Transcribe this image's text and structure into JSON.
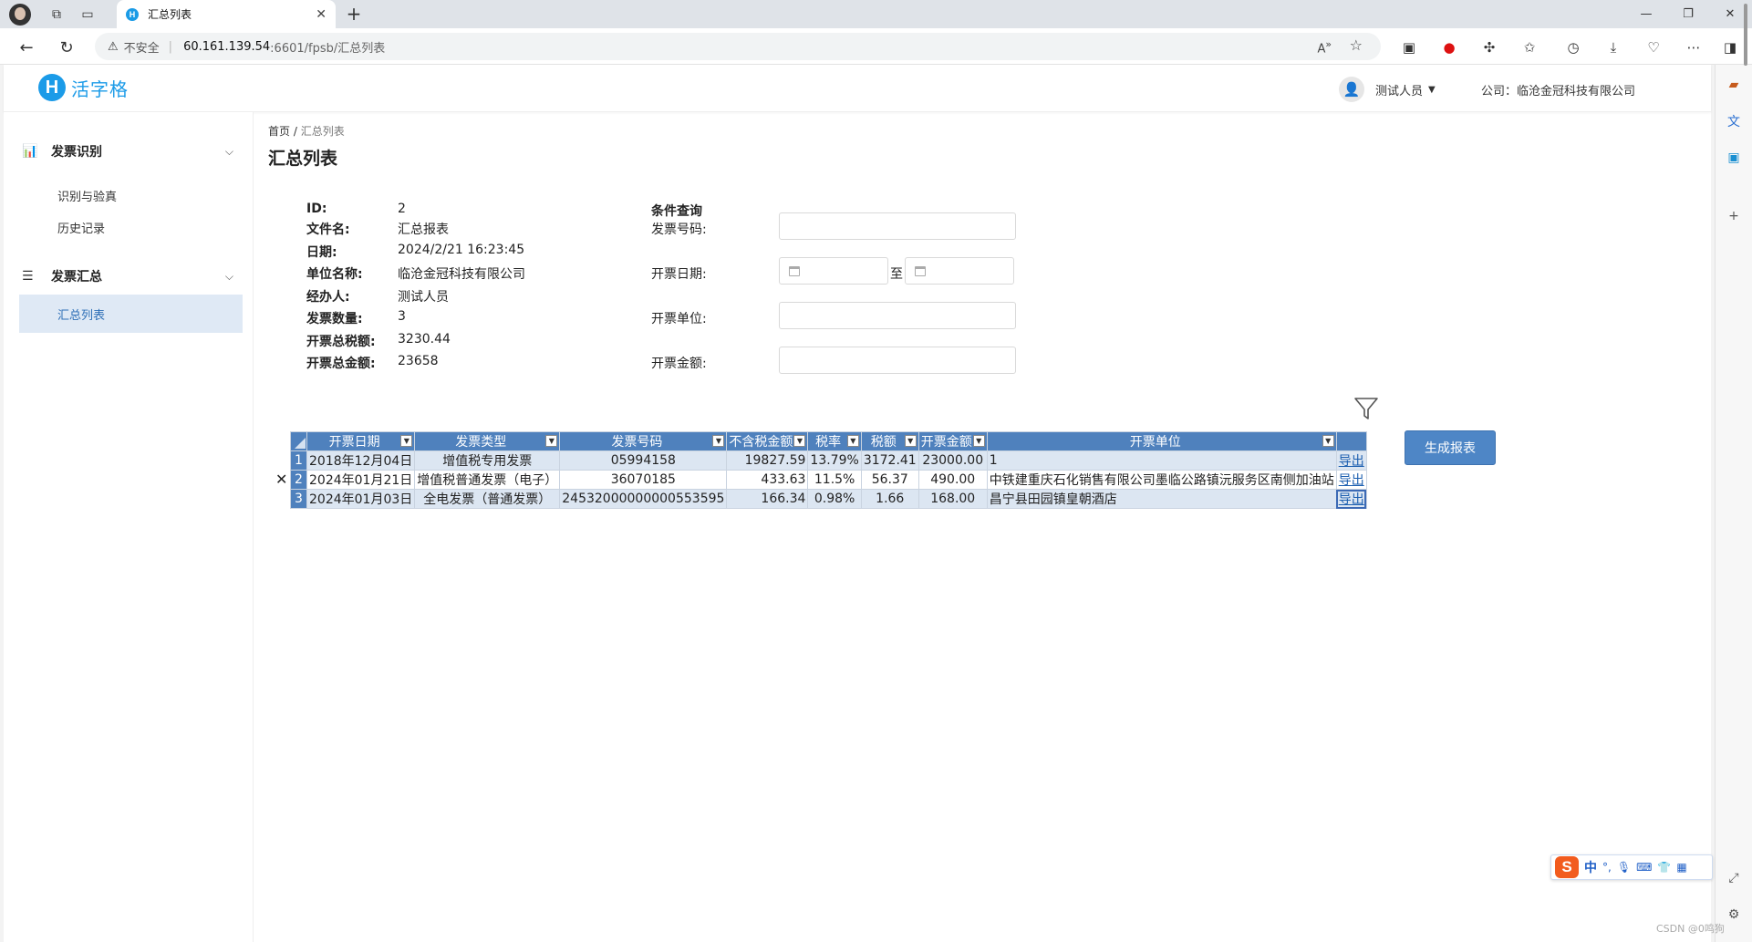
{
  "browser": {
    "tab_title": "汇总列表",
    "tab_favicon": "H",
    "url_warning": "不安全",
    "url_host": "60.161.139.54",
    "url_rest": ":6601/fpsb/汇总列表",
    "new_tab": "+",
    "minimize": "—",
    "restore": "❐",
    "close": "✕"
  },
  "app": {
    "logo_mark": "H",
    "brand": "活字格",
    "user_name": "测试人员",
    "company_label": "公司：临沧金冠科技有限公司"
  },
  "sidebar": {
    "groups": [
      {
        "label": "发票识别",
        "icon": "bar-chart-icon"
      },
      {
        "label": "发票汇总",
        "icon": "document-icon"
      }
    ],
    "items": [
      {
        "label": "识别与验真"
      },
      {
        "label": "历史记录"
      },
      {
        "label": "汇总列表",
        "active": true
      }
    ]
  },
  "breadcrumb": {
    "home": "首页 /",
    "current": "汇总列表"
  },
  "page_title": "汇总列表",
  "info": [
    {
      "label": "ID:",
      "value": "2"
    },
    {
      "label": "文件名:",
      "value": "汇总报表"
    },
    {
      "label": "日期:",
      "value": "2024/2/21 16:23:45"
    },
    {
      "label": "单位名称:",
      "value": "临沧金冠科技有限公司"
    },
    {
      "label": "经办人:",
      "value": "测试人员"
    },
    {
      "label": "发票数量:",
      "value": "3"
    },
    {
      "label": "开票总税额:",
      "value": "3230.44"
    },
    {
      "label": "开票总金额:",
      "value": "23658"
    }
  ],
  "query": {
    "title": "条件查询",
    "invoice_no_label": "发票号码:",
    "date_label": "开票日期:",
    "date_to": "至",
    "unit_label": "开票单位:",
    "amount_label": "开票金额:",
    "invoice_no_value": "",
    "unit_value": "",
    "amount_value": ""
  },
  "generate_button": "生成报表",
  "table": {
    "headers": [
      "开票日期",
      "发票类型",
      "发票号码",
      "不含税金额",
      "税率",
      "税额",
      "开票金额",
      "开票单位"
    ],
    "rows": [
      {
        "n": "1",
        "date": "2018年12月04日",
        "type": "增值税专用发票",
        "no": "05994158",
        "net": "19827.59",
        "rate": "13.79%",
        "tax": "3172.41",
        "total": "23000.00",
        "unit": "1",
        "action": "导出"
      },
      {
        "n": "2",
        "date": "2024年01月21日",
        "type": "增值税普通发票（电子）",
        "no": "36070185",
        "net": "433.63",
        "rate": "11.5%",
        "tax": "56.37",
        "total": "490.00",
        "unit": "中铁建重庆石化销售有限公司墨临公路镇沅服务区南侧加油站",
        "action": "导出"
      },
      {
        "n": "3",
        "date": "2024年01月03日",
        "type": "全电发票（普通发票）",
        "no": "24532000000000553595",
        "net": "166.34",
        "rate": "0.98%",
        "tax": "1.66",
        "total": "168.00",
        "unit": "昌宁县田园镇皇朝酒店",
        "action": "导出"
      }
    ]
  },
  "ime": {
    "logo": "S",
    "mode": "中",
    "punct": "°,"
  },
  "watermark": "CSDN @0鸣狗"
}
